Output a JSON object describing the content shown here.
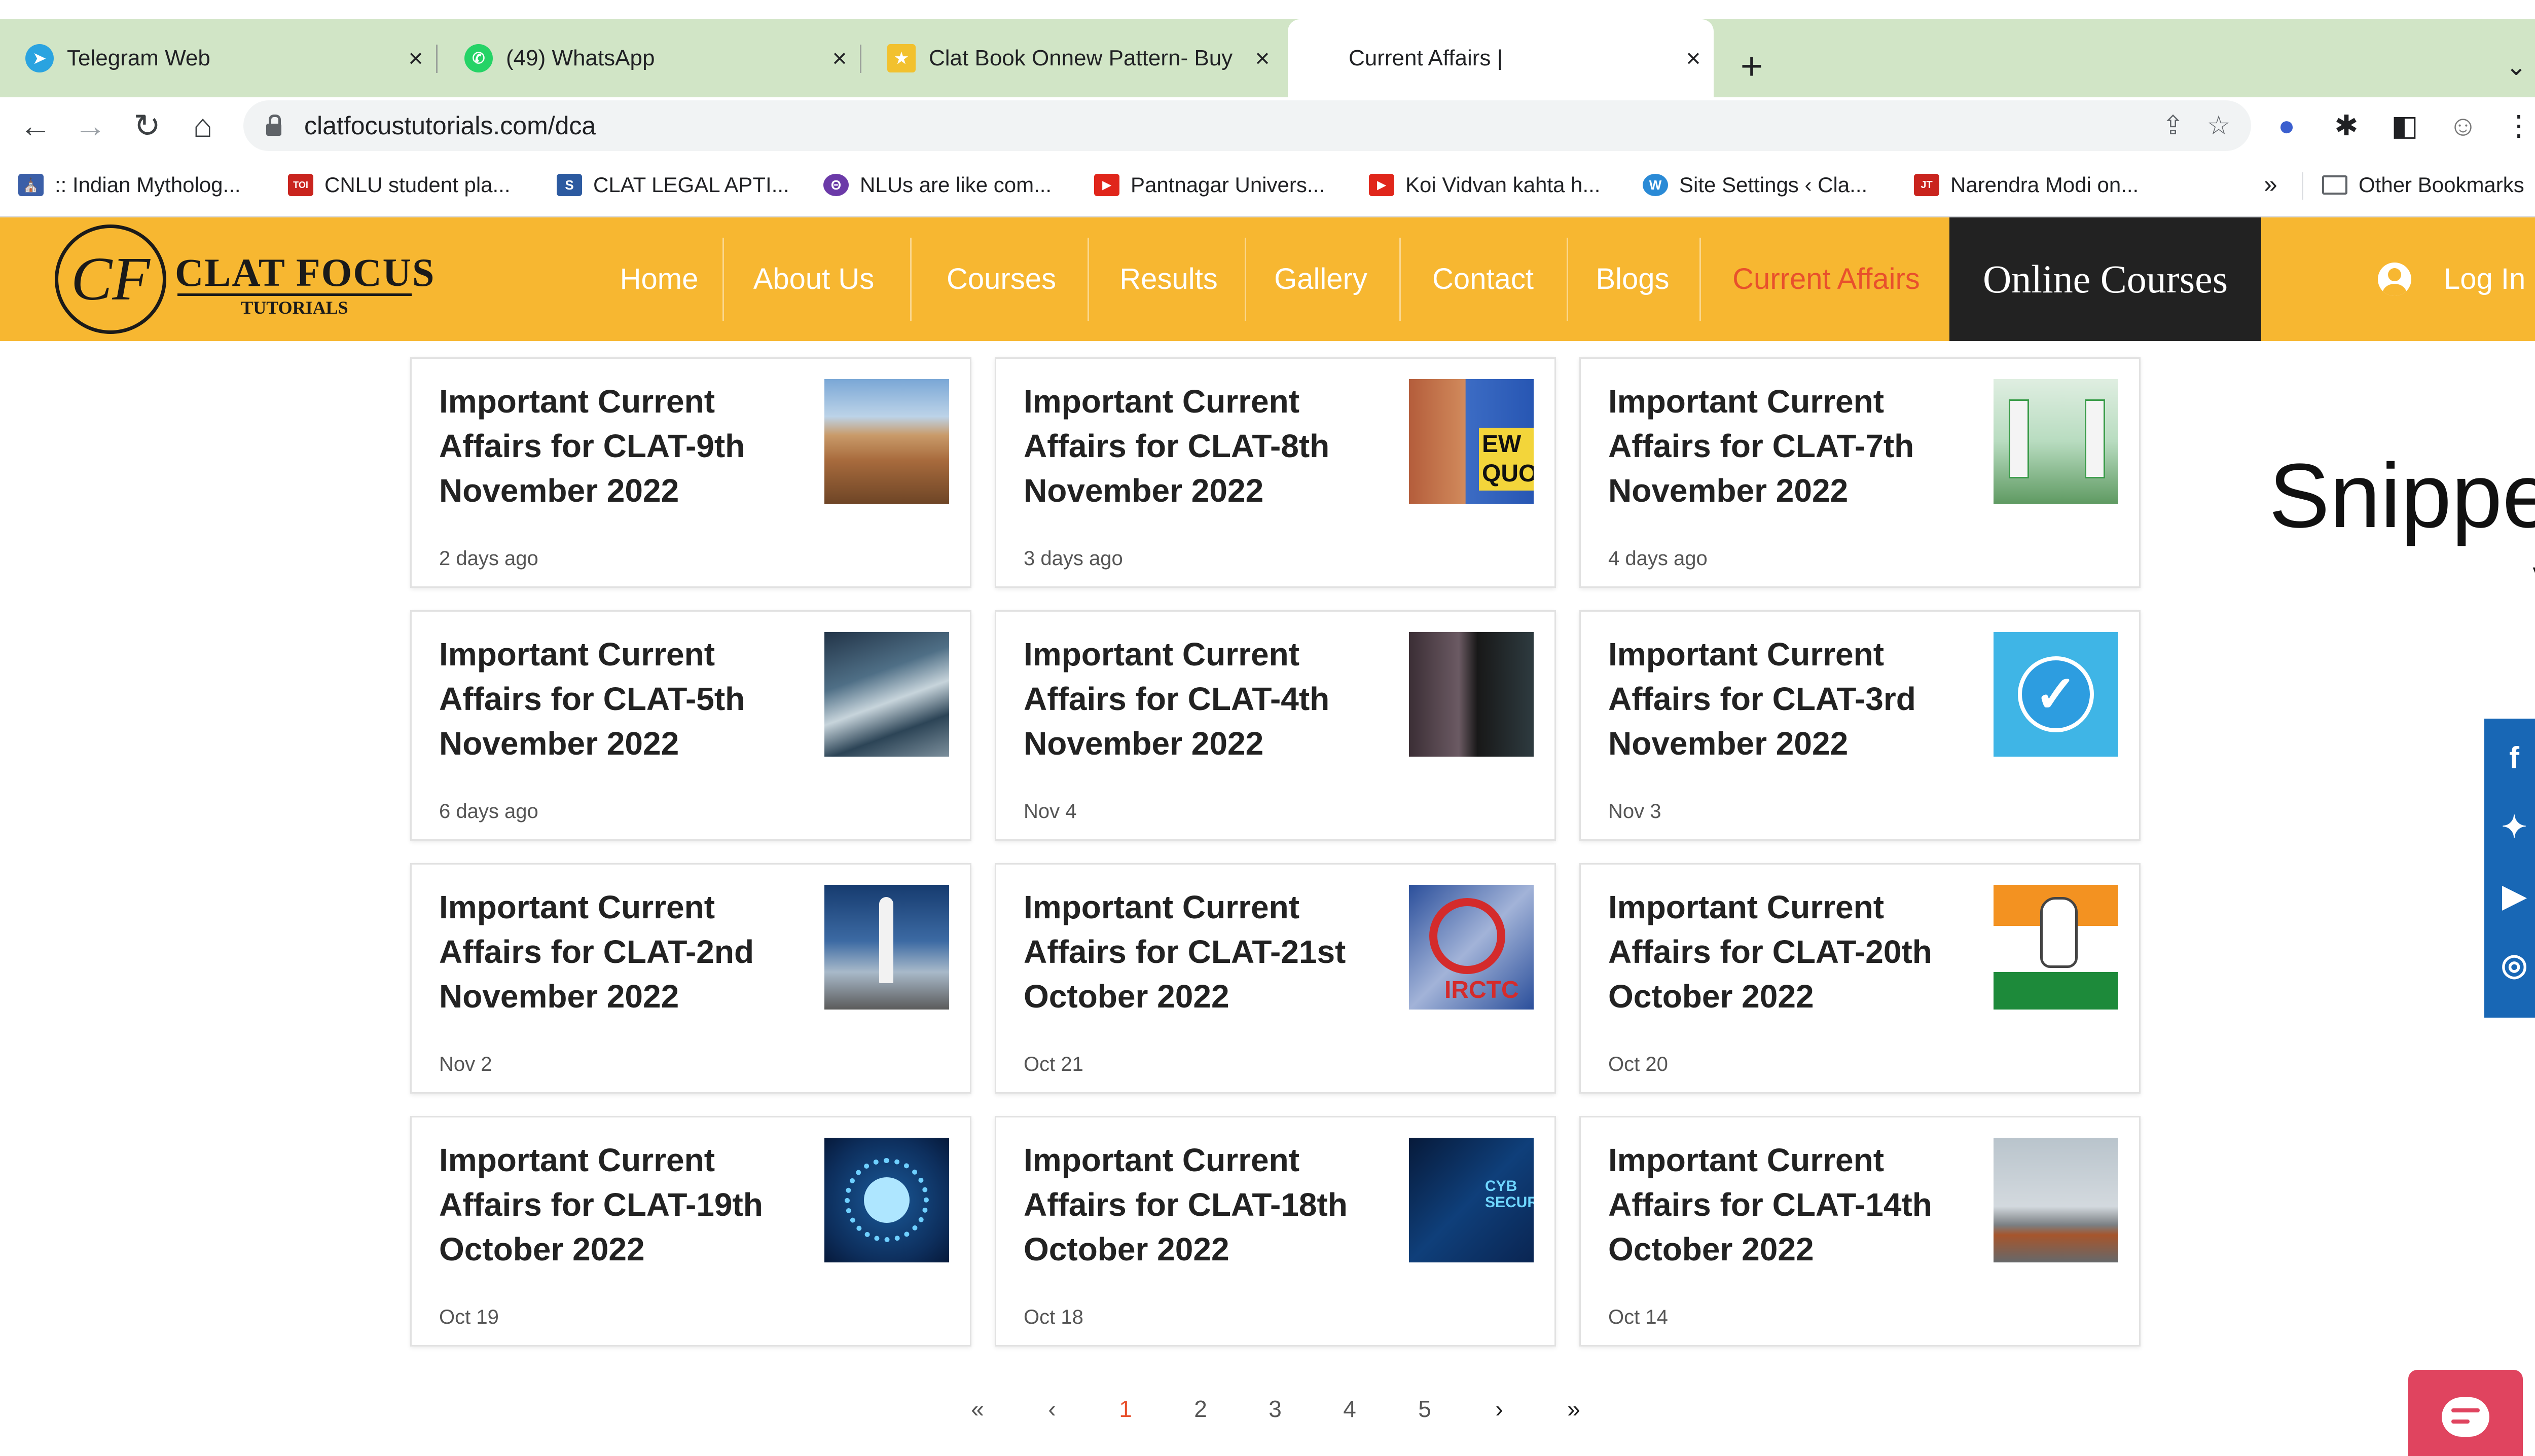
{
  "browser": {
    "tabs": [
      {
        "title": "Telegram Web",
        "icon_color": "#2aa3e0",
        "icon_glyph": "➤",
        "active": false
      },
      {
        "title": "(49) WhatsApp",
        "icon_color": "#25d366",
        "icon_glyph": "✆",
        "active": false
      },
      {
        "title": "Clat Book Onnew Pattern- Buy",
        "icon_color": "#f2c12e",
        "icon_glyph": "★",
        "active": false
      },
      {
        "title": "Current Affairs |",
        "icon_color": "",
        "icon_glyph": "",
        "active": true
      }
    ],
    "new_tab_label": "+",
    "url": "clatfocustutorials.com/dca",
    "bookmarks": [
      {
        "label": ":: Indian Mytholog...",
        "icon_color": "#3b5fa8",
        "icon_glyph": "⛪"
      },
      {
        "label": "CNLU student pla...",
        "icon_color": "#c9241e",
        "icon_glyph": "TOI"
      },
      {
        "label": "CLAT LEGAL APTI...",
        "icon_color": "#2c5aa0",
        "icon_glyph": "S"
      },
      {
        "label": "NLUs are like com...",
        "icon_color": "#6b3aa8",
        "icon_glyph": "Θ"
      },
      {
        "label": "Pantnagar Univers...",
        "icon_color": "#e0261b",
        "icon_glyph": "▶"
      },
      {
        "label": "Koi Vidvan kahta h...",
        "icon_color": "#e0261b",
        "icon_glyph": "▶"
      },
      {
        "label": "Site Settings ‹ Cla...",
        "icon_color": "#2a8ad6",
        "icon_glyph": "W"
      },
      {
        "label": "Narendra Modi on...",
        "icon_color": "#c9241e",
        "icon_glyph": "JT"
      }
    ],
    "bookmarks_more": "»",
    "other_bookmarks": "Other Bookmarks"
  },
  "site": {
    "logo_monogram": "CF",
    "logo_title": "CLAT FOCUS",
    "logo_subtitle": "TUTORIALS",
    "nav": [
      "Home",
      "About Us",
      "Courses",
      "Results",
      "Gallery",
      "Contact",
      "Blogs",
      "Current Affairs"
    ],
    "online_courses": "Online Courses",
    "login": "Log In"
  },
  "posts": [
    {
      "title": "Important Current Affairs for CLAT-9th November 2022",
      "date": "2 days ago",
      "thumb": "city"
    },
    {
      "title": "Important Current Affairs for CLAT-8th November 2022",
      "date": "3 days ago",
      "thumb": "court",
      "thumb_text": "EW QUO"
    },
    {
      "title": "Important Current Affairs for CLAT-7th November 2022",
      "date": "4 days ago",
      "thumb": "charge"
    },
    {
      "title": "Important Current Affairs for CLAT-5th November 2022",
      "date": "6 days ago",
      "thumb": "wave"
    },
    {
      "title": "Important Current Affairs for CLAT-4th November 2022",
      "date": "Nov 4",
      "thumb": "dark"
    },
    {
      "title": "Important Current Affairs for CLAT-3rd November 2022",
      "date": "Nov 3",
      "thumb": "tick"
    },
    {
      "title": "Important Current Affairs for CLAT-2nd November 2022",
      "date": "Nov 2",
      "thumb": "rocket"
    },
    {
      "title": "Important Current Affairs for CLAT-21st October 2022",
      "date": "Oct 21",
      "thumb": "irctc",
      "thumb_text": "IRCTC"
    },
    {
      "title": "Important Current Affairs for CLAT-20th October 2022",
      "date": "Oct 20",
      "thumb": "flag"
    },
    {
      "title": "Important Current Affairs for CLAT-19th October 2022",
      "date": "Oct 19",
      "thumb": "circuit"
    },
    {
      "title": "Important Current Affairs for CLAT-18th October 2022",
      "date": "Oct 18",
      "thumb": "cyber",
      "thumb_text": "CYB SECUR"
    },
    {
      "title": "Important Current Affairs for CLAT-14th October 2022",
      "date": "Oct 14",
      "thumb": "plane"
    }
  ],
  "pagination": {
    "first": "«",
    "prev": "‹",
    "pages": [
      "1",
      "2",
      "3",
      "4",
      "5"
    ],
    "current": "1",
    "next": "›",
    "last": "»"
  },
  "side_text": {
    "line1": "Snippe",
    "line2": "V"
  },
  "social_icons": [
    "facebook-icon",
    "twitter-icon",
    "youtube-icon",
    "instagram-icon"
  ],
  "colors": {
    "header": "#f7b731",
    "accent": "#e8502c",
    "social": "#1867b5",
    "chat": "#e0445f"
  }
}
